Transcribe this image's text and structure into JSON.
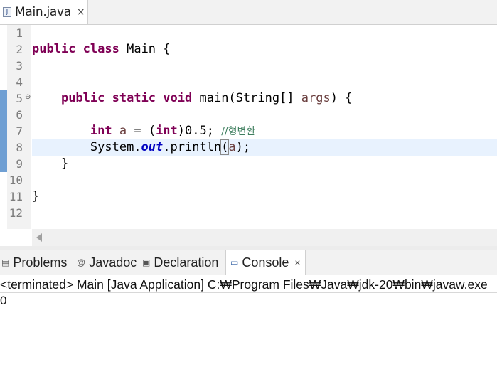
{
  "editor_tab": {
    "icon": "java-file-icon",
    "label": "Main.java",
    "close": "×"
  },
  "line_numbers": [
    "1",
    "2",
    "3",
    "4",
    "5",
    "6",
    "7",
    "8",
    "9",
    "10",
    "11",
    "12"
  ],
  "code": {
    "line2": {
      "kw1": "public",
      "kw2": "class",
      "rest": " Main {"
    },
    "line5": {
      "indent": "    ",
      "kw1": "public",
      "kw2": "static",
      "kw3": "void",
      "rest": " main(String[] ",
      "param": "args",
      "end": ") {"
    },
    "line7": {
      "indent": "        ",
      "kw1": "int",
      "var": "a",
      "mid": " = (",
      "kw2": "int",
      "after": ")0.5; ",
      "comment": "//형변환"
    },
    "line8": {
      "indent": "        ",
      "pre": "System.",
      "field": "out",
      "call": ".println",
      "open": "(",
      "arg": "a",
      "end": ");"
    },
    "line9": {
      "text": "    }"
    },
    "line11": {
      "text": "}"
    }
  },
  "bottom_tabs": {
    "problems": "Problems",
    "javadoc": "Javadoc",
    "declaration": "Declaration",
    "console": "Console",
    "close": "×"
  },
  "console": {
    "header": "<terminated> Main [Java Application] C:₩Program Files₩Java₩jdk-20₩bin₩javaw.exe",
    "output": "0"
  },
  "colors": {
    "keyword": "#7f0055",
    "field": "#0000c0",
    "comment": "#3f7f5f",
    "local_variable": "#6a3e3e",
    "current_line": "#e8f2fe",
    "change_marker": "#6f9fd3"
  }
}
